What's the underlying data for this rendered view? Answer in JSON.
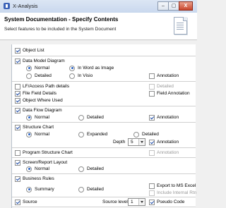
{
  "window": {
    "title": "X-Analysis",
    "controls": [
      "–",
      "▢",
      "X"
    ]
  },
  "header": {
    "title": "System Documentation - Specify Contents",
    "subtitle": "Select features to be included in the System Document"
  },
  "options": {
    "object_list": "Object List",
    "data_model_diagram": "Data Model Diagram",
    "dmd_normal": "Normal",
    "dmd_in_word_as_image": "In Word as Image",
    "dmd_detailed": "Detailed",
    "dmd_in_visio": "In Visio",
    "dmd_annotation": "Annotation",
    "lf_access_path": "LF/Access Path details",
    "lf_detailed": "Detailed",
    "file_field_details": "File Field Details",
    "field_annotation": "Field Annotation",
    "object_where_used": "Object Where Used",
    "data_flow_diagram": "Data Flow Diagram",
    "dfd_normal": "Normal",
    "dfd_detailed": "Detailed",
    "dfd_annotation": "Annotation",
    "structure_chart": "Structure Chart",
    "sc_normal": "Normal",
    "sc_expanded": "Expanded",
    "sc_detailed": "Detailed",
    "sc_depth_label": "Depth",
    "sc_depth_value": "5",
    "sc_annotation": "Annotation",
    "program_structure_chart": "Program Structure Chart",
    "psc_annotation": "Annotation",
    "screen_report_layout": "Screen/Report Layout",
    "srl_normal": "Normal",
    "srl_detailed": "Detailed",
    "business_rules": "Business Rules",
    "br_summary": "Summary",
    "br_detailed": "Detailed",
    "export_ms_excel": "Export to MS Excel",
    "include_internal": "Include Internal Rtn",
    "source": "Source",
    "source_level_label": "Source level",
    "source_level_value": "1",
    "pseudo_code": "Pseudo Code"
  }
}
